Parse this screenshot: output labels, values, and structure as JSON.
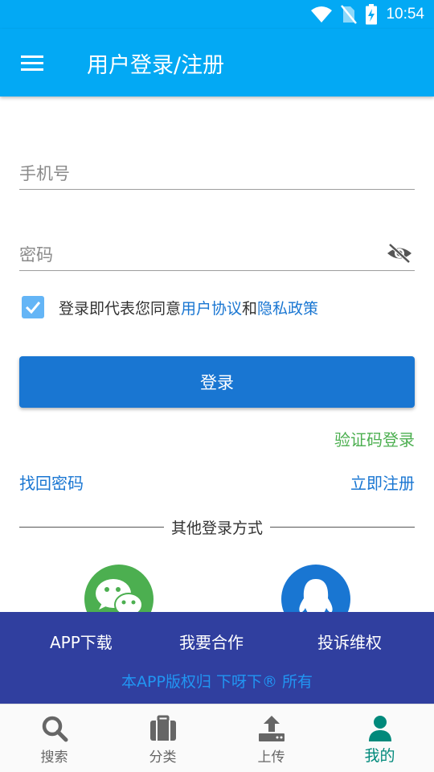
{
  "status": {
    "time": "10:54",
    "icons": [
      "wifi-icon",
      "no-sim-icon",
      "battery-charging-icon"
    ]
  },
  "header": {
    "title": "用户登录/注册",
    "menu_icon": "menu-icon"
  },
  "form": {
    "phone_placeholder": "手机号",
    "password_placeholder": "密码",
    "password_toggle_icon": "eye-off-icon",
    "agree_checked": true,
    "agree_prefix": "登录即代表您同意",
    "agree_link1": "用户协议",
    "agree_and": "和",
    "agree_link2": "隐私政策",
    "login_button": "登录",
    "sms_login": "验证码登录",
    "forgot_password": "找回密码",
    "register_now": "立即注册"
  },
  "other_login": {
    "label": "其他登录方式",
    "options": [
      "wechat-icon",
      "qq-icon"
    ]
  },
  "footer": {
    "links": [
      "APP下载",
      "我要合作",
      "投诉维权"
    ],
    "copyright": "本APP版权归 下呀下® 所有"
  },
  "bottom_nav": {
    "items": [
      {
        "label": "搜索",
        "icon": "search-icon"
      },
      {
        "label": "分类",
        "icon": "briefcase-icon"
      },
      {
        "label": "上传",
        "icon": "upload-icon"
      },
      {
        "label": "我的",
        "icon": "person-icon",
        "active": true
      }
    ]
  },
  "colors": {
    "primary": "#03a9f4",
    "button": "#1976d2",
    "link": "#1976d2",
    "sms_link": "#4caf50",
    "footer_bg": "#303f9f",
    "active_tab": "#00897b"
  }
}
